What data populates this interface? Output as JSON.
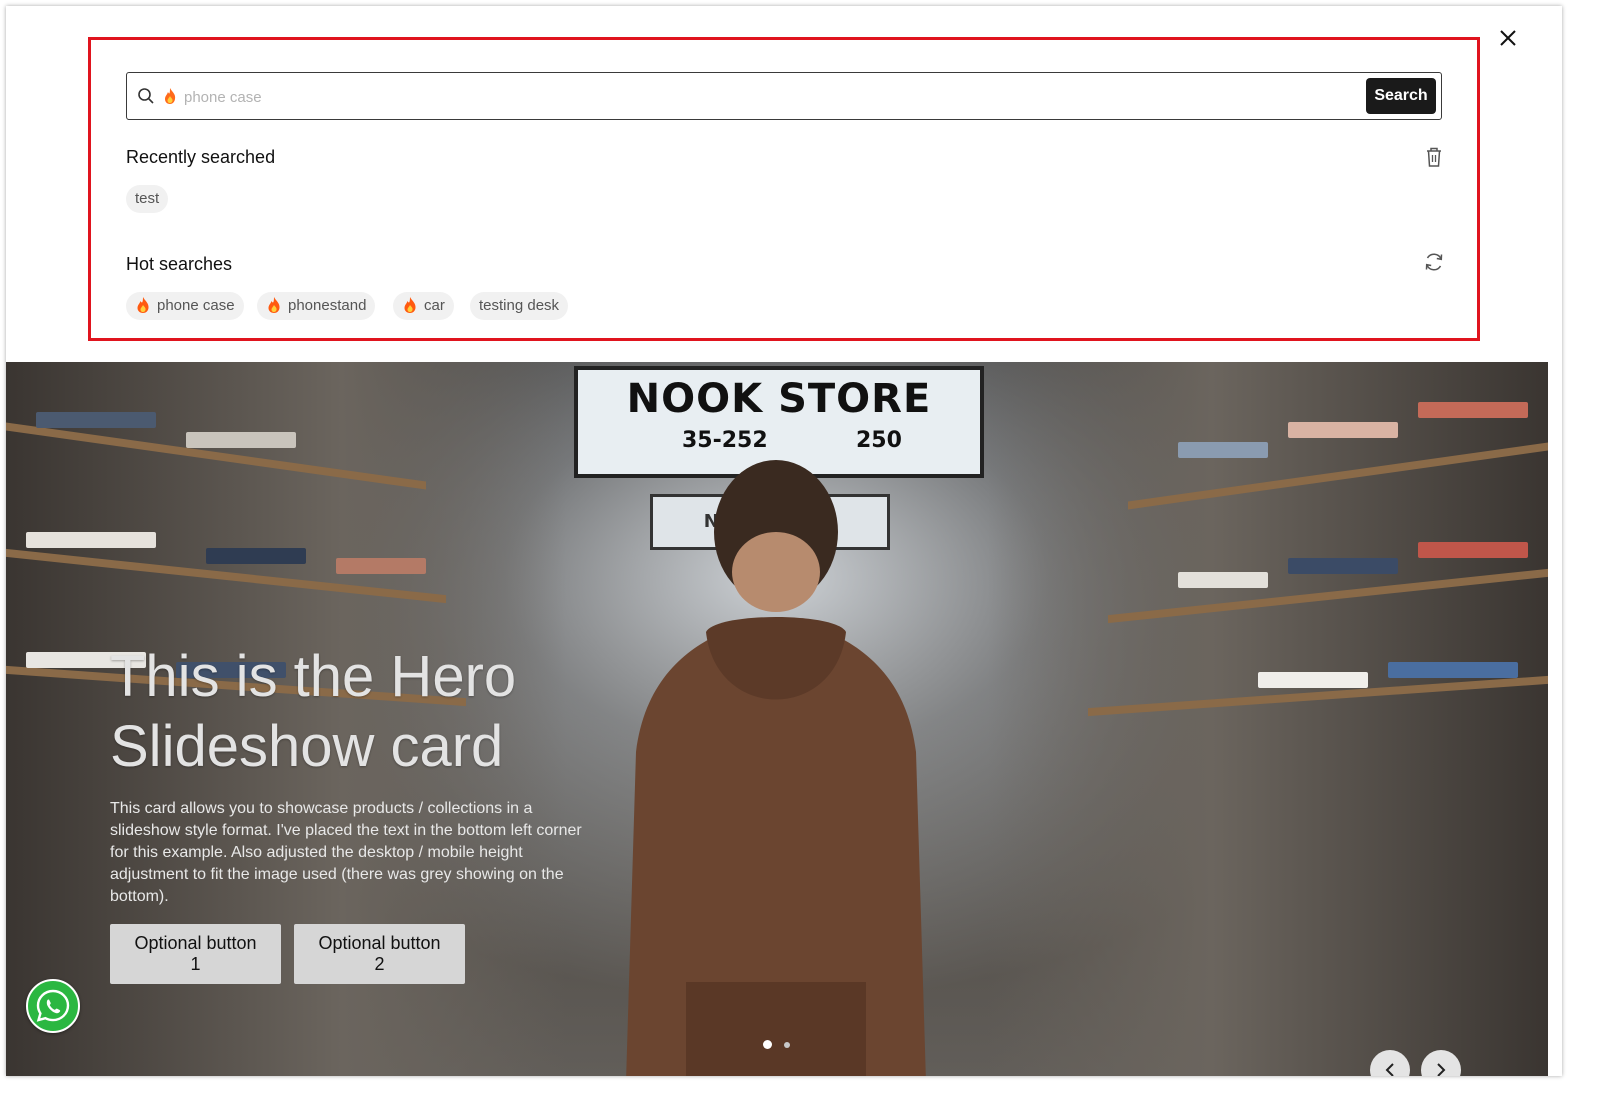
{
  "search": {
    "placeholder": "phone case",
    "button_label": "Search"
  },
  "recent": {
    "title": "Recently searched",
    "items": [
      "test"
    ]
  },
  "hot": {
    "title": "Hot searches",
    "items": [
      {
        "label": "phone case",
        "icon": "hot-flame-icon"
      },
      {
        "label": "phonestand",
        "icon": "hot-flame-icon"
      },
      {
        "label": "car",
        "icon": "hot-flame-icon"
      },
      {
        "label": "testing desk",
        "icon": ""
      }
    ]
  },
  "hero": {
    "store_sign": "NOOK STORE",
    "store_sign_nums": [
      "35-252",
      "250"
    ],
    "store_sign_small": "NOOK STORE",
    "title_line1": "This is the Hero",
    "title_line2": "Slideshow card",
    "body": "This card allows you to showcase products / collections in a slideshow style format. I've placed the text in the bottom left corner for this example. Also adjusted the desktop / mobile height adjustment to fit the image used (there was grey showing on the bottom).",
    "button1": "Optional button 1",
    "button2": "Optional button 2",
    "slide_count": 2,
    "active_slide": 1
  },
  "colors": {
    "highlight": "#e0141e",
    "search_button_bg": "#1a1a1a",
    "chip_bg": "#f1f1f1",
    "whatsapp": "#2bb741"
  }
}
